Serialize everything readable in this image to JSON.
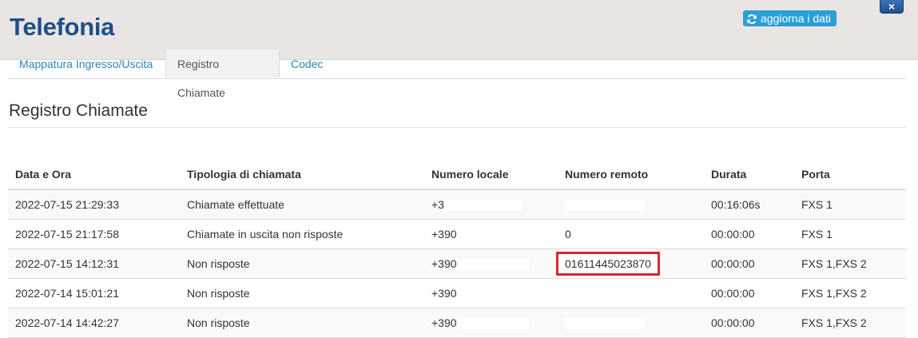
{
  "header": {
    "title": "Telefonia",
    "refresh_label": "aggiorna i dati",
    "close_label": "×"
  },
  "tabs": [
    {
      "label": "Mappatura Ingresso/Uscita",
      "active": false
    },
    {
      "label": "Registro Chiamate",
      "active": true
    },
    {
      "label": "Codec",
      "active": false
    }
  ],
  "section": {
    "title": "Registro Chiamate"
  },
  "table": {
    "columns": [
      "Data e Ora",
      "Tipologia di chiamata",
      "Numero locale",
      "Numero remoto",
      "Durata",
      "Porta"
    ],
    "rows": [
      {
        "datetime": "2022-07-15 21:29:33",
        "type": "Chiamate effettuate",
        "local": "+3",
        "remote": "",
        "duration": "00:16:06s",
        "port": "FXS 1"
      },
      {
        "datetime": "2022-07-15 21:17:58",
        "type": "Chiamate in uscita non risposte",
        "local": "+390",
        "remote": "0",
        "duration": "00:00:00",
        "port": "FXS 1"
      },
      {
        "datetime": "2022-07-15 14:12:31",
        "type": "Non risposte",
        "local": "+390",
        "remote": "01611445023870",
        "duration": "00:00:00",
        "port": "FXS 1,FXS 2"
      },
      {
        "datetime": "2022-07-14 15:01:21",
        "type": "Non risposte",
        "local": "+390",
        "remote": "",
        "duration": "00:00:00",
        "port": "FXS 1,FXS 2"
      },
      {
        "datetime": "2022-07-14 14:42:27",
        "type": "Non risposte",
        "local": "+390",
        "remote": "",
        "duration": "00:00:00",
        "port": "FXS 1,FXS 2"
      }
    ]
  },
  "colors": {
    "title": "#1f4f8b",
    "accent": "#2a9fd6",
    "tab_link": "#2a86b8",
    "highlight_border": "#d9272e"
  },
  "icons": {
    "refresh": "refresh-icon",
    "close": "close-icon"
  }
}
